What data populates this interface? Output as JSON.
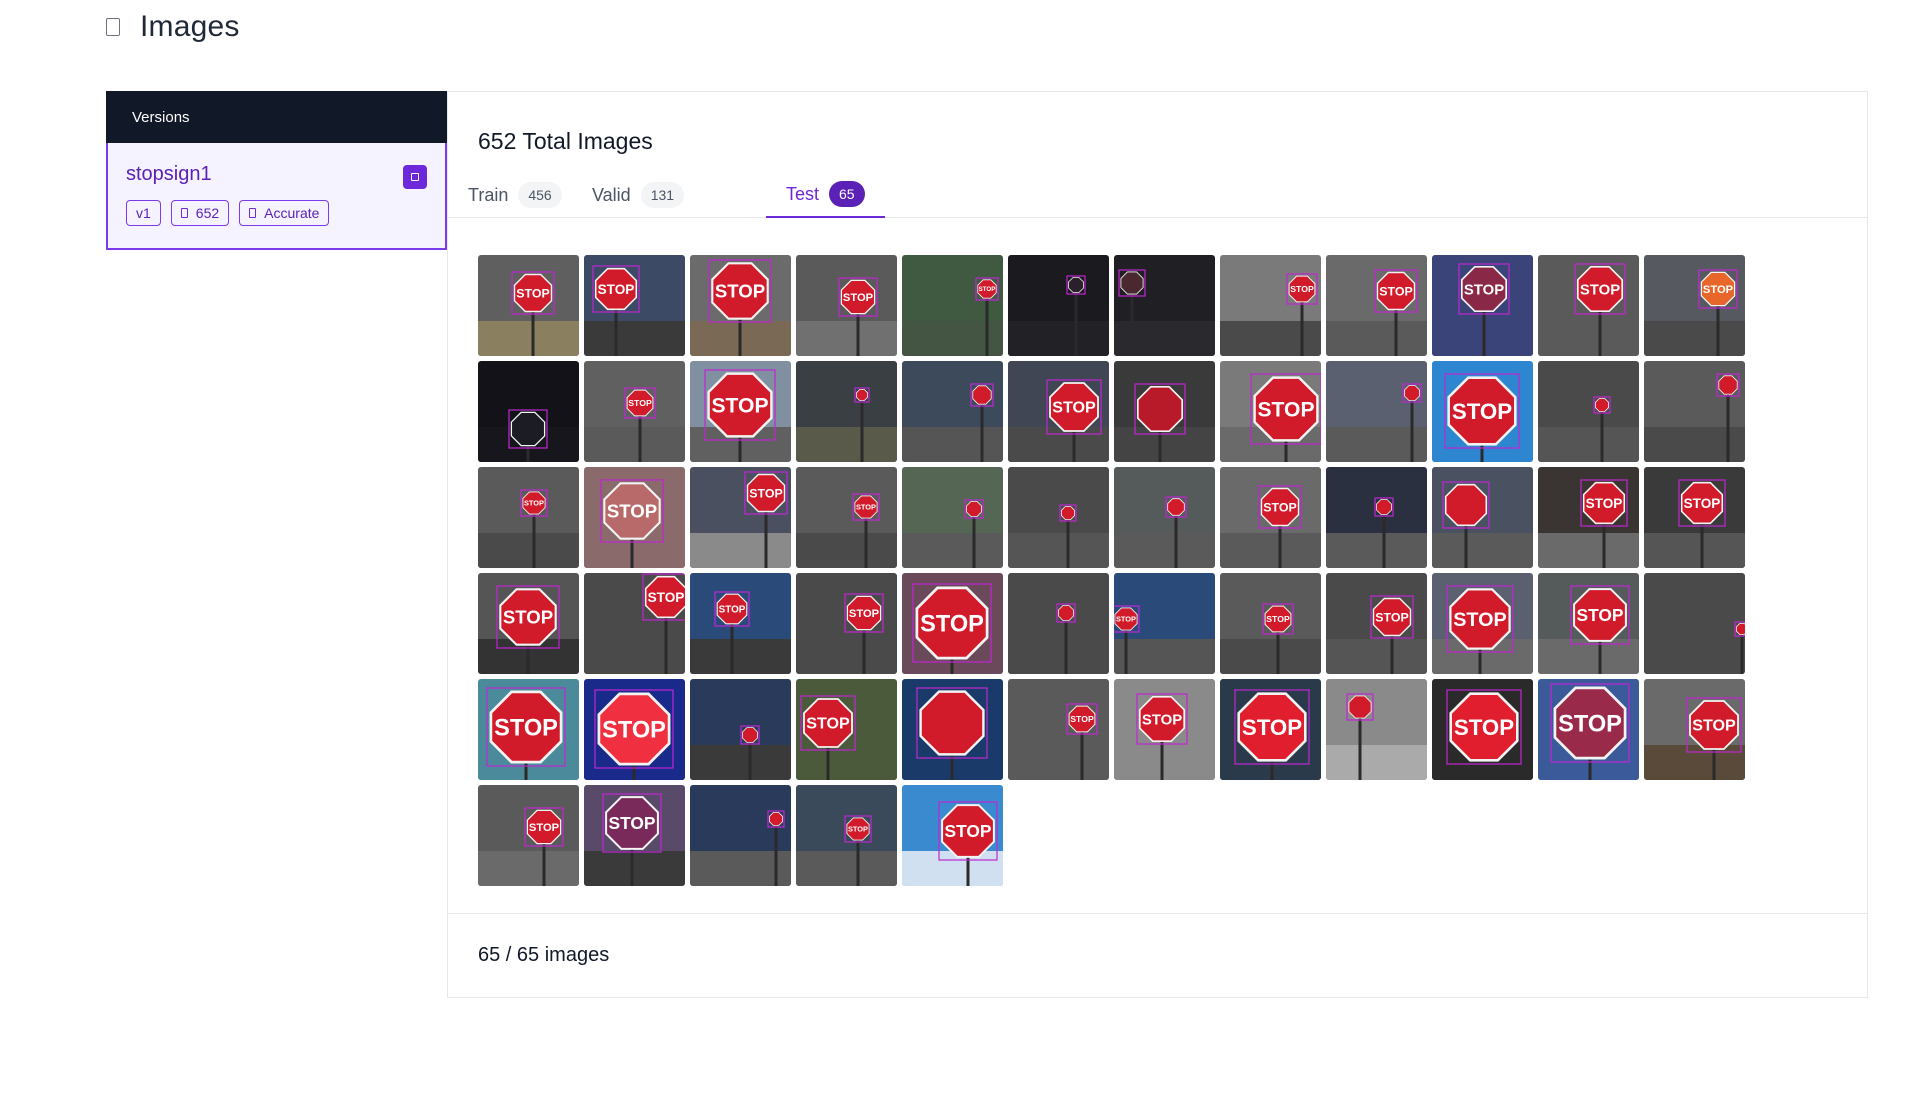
{
  "header": {
    "title": "Images",
    "icon": "image-icon"
  },
  "sidebar": {
    "title": "Versions",
    "version": {
      "name": "stopsign1",
      "chips": [
        {
          "label": "v1",
          "icon": ""
        },
        {
          "label": "652",
          "icon": "image-icon"
        },
        {
          "label": "Accurate",
          "icon": "doc-icon"
        }
      ]
    }
  },
  "main": {
    "total": "652 Total Images",
    "tabs": [
      {
        "label": "Train",
        "count": "456",
        "active": false
      },
      {
        "label": "Valid",
        "count": "131",
        "active": false
      },
      {
        "label": "Test",
        "count": "65",
        "active": true
      }
    ],
    "footer": "65 / 65 images"
  },
  "colors": {
    "accent": "#6d28d9",
    "sidebar_header": "#111827",
    "stop_red": "#d11a2a",
    "bbox": "#c026d3"
  },
  "thumbnails": [
    {
      "bg": "#5f5f5f",
      "ground": "#8a8060",
      "sign": "#d11a2a",
      "text": "STOP"
    },
    {
      "bg": "#3c4a66",
      "ground": "#3a3a3a",
      "sign": "#d11a2a",
      "text": "STOP"
    },
    {
      "bg": "#6b6b6b",
      "ground": "#7a6a55",
      "sign": "#d11a2a",
      "text": "STOP"
    },
    {
      "bg": "#5a5a5a",
      "ground": "#707070",
      "sign": "#d11a2a",
      "text": "STOP"
    },
    {
      "bg": "#3f5a40",
      "ground": "#445544",
      "sign": "#d11a2a",
      "text": "STOP"
    },
    {
      "bg": "#1a1a1f",
      "ground": "#222226",
      "sign": "#2a1f2a",
      "text": ""
    },
    {
      "bg": "#202024",
      "ground": "#2a2a2e",
      "sign": "#4a2830",
      "text": ""
    },
    {
      "bg": "#7a7a7a",
      "ground": "#4a4a4a",
      "sign": "#d11a2a",
      "text": "STOP"
    },
    {
      "bg": "#6a6a6a",
      "ground": "#5a5a5a",
      "sign": "#d11a2a",
      "text": "STOP"
    },
    {
      "bg": "#3a4478",
      "ground": "#3a4478",
      "sign": "#8a2848",
      "text": "STOP"
    },
    {
      "bg": "#5a5a5a",
      "ground": "#5a5a5a",
      "sign": "#d11a2a",
      "text": "STOP"
    },
    {
      "bg": "#565a60",
      "ground": "#4a4a4a",
      "sign": "#e8662a",
      "text": "STOP"
    },
    {
      "bg": "#121218",
      "ground": "#16161c",
      "sign": "#1c1c24",
      "text": ""
    },
    {
      "bg": "#606060",
      "ground": "#5a5a5a",
      "sign": "#d11a2a",
      "text": "STOP"
    },
    {
      "bg": "#8090a0",
      "ground": "#606060",
      "sign": "#d11a2a",
      "text": "STOP"
    },
    {
      "bg": "#3a3f44",
      "ground": "#5a5a4a",
      "sign": "#d11a2a",
      "text": ""
    },
    {
      "bg": "#3c4a5c",
      "ground": "#555555",
      "sign": "#d11a2a",
      "text": ""
    },
    {
      "bg": "#404654",
      "ground": "#4a4a4a",
      "sign": "#d11a2a",
      "text": "STOP"
    },
    {
      "bg": "#3a3a3a",
      "ground": "#444444",
      "sign": "#b81a2a",
      "text": ""
    },
    {
      "bg": "#7a7a7a",
      "ground": "#6a6a6a",
      "sign": "#d11a2a",
      "text": "STOP"
    },
    {
      "bg": "#5a6070",
      "ground": "#5a5a5a",
      "sign": "#d11a2a",
      "text": ""
    },
    {
      "bg": "#2e86d0",
      "ground": "#2e86d0",
      "sign": "#d11a2a",
      "text": "STOP"
    },
    {
      "bg": "#4a4a4a",
      "ground": "#555555",
      "sign": "#d11a2a",
      "text": ""
    },
    {
      "bg": "#5a5a5a",
      "ground": "#4a4a4a",
      "sign": "#d11a2a",
      "text": ""
    },
    {
      "bg": "#5a5a5a",
      "ground": "#4a4a4a",
      "sign": "#d11a2a",
      "text": "STOP"
    },
    {
      "bg": "#8a6a6a",
      "ground": "#8a6a6a",
      "sign": "#b86a6a",
      "text": "STOP"
    },
    {
      "bg": "#4a5060",
      "ground": "#8a8a8a",
      "sign": "#d11a2a",
      "text": "STOP"
    },
    {
      "bg": "#5a5a5a",
      "ground": "#4a4a4a",
      "sign": "#d11a2a",
      "text": "STOP"
    },
    {
      "bg": "#556655",
      "ground": "#5a5a5a",
      "sign": "#d11a2a",
      "text": ""
    },
    {
      "bg": "#4a4a4a",
      "ground": "#555555",
      "sign": "#d11a2a",
      "text": ""
    },
    {
      "bg": "#555a5a",
      "ground": "#5a5a5a",
      "sign": "#d11a2a",
      "text": ""
    },
    {
      "bg": "#6a6a6a",
      "ground": "#5a5a5a",
      "sign": "#d11a2a",
      "text": "STOP"
    },
    {
      "bg": "#2a3040",
      "ground": "#5a5a5a",
      "sign": "#d11a2a",
      "text": ""
    },
    {
      "bg": "#4a5262",
      "ground": "#5a5a5a",
      "sign": "#d11a2a",
      "text": ""
    },
    {
      "bg": "#3a3532",
      "ground": "#6a6a6a",
      "sign": "#d11a2a",
      "text": "STOP"
    },
    {
      "bg": "#3a3a3a",
      "ground": "#555555",
      "sign": "#d11a2a",
      "text": "STOP"
    },
    {
      "bg": "#555555",
      "ground": "#333333",
      "sign": "#d11a2a",
      "text": "STOP"
    },
    {
      "bg": "#4a4a4a",
      "ground": "#4a4a4a",
      "sign": "#d11a2a",
      "text": "STOP"
    },
    {
      "bg": "#2a4a7a",
      "ground": "#3a3a3a",
      "sign": "#d11a2a",
      "text": "STOP"
    },
    {
      "bg": "#4a4a4a",
      "ground": "#4a4a4a",
      "sign": "#d11a2a",
      "text": "STOP"
    },
    {
      "bg": "#6a4a5a",
      "ground": "#6a4a5a",
      "sign": "#d11a2a",
      "text": "STOP"
    },
    {
      "bg": "#4a4a4a",
      "ground": "#4a4a4a",
      "sign": "#d11a2a",
      "text": ""
    },
    {
      "bg": "#2a4a7a",
      "ground": "#555555",
      "sign": "#d11a2a",
      "text": "STOP"
    },
    {
      "bg": "#5a5a5a",
      "ground": "#4a4a4a",
      "sign": "#d11a2a",
      "text": "STOP"
    },
    {
      "bg": "#4a4a4a",
      "ground": "#555555",
      "sign": "#d11a2a",
      "text": "STOP"
    },
    {
      "bg": "#5a6070",
      "ground": "#6a6a6a",
      "sign": "#d11a2a",
      "text": "STOP"
    },
    {
      "bg": "#555a5a",
      "ground": "#6a6a6a",
      "sign": "#d11a2a",
      "text": "STOP"
    },
    {
      "bg": "#4a4a4a",
      "ground": "#4a4a4a",
      "sign": "#d11a2a",
      "text": ""
    },
    {
      "bg": "#4a8a9a",
      "ground": "#4a8a9a",
      "sign": "#d11a2a",
      "text": "STOP"
    },
    {
      "bg": "#1a2a8a",
      "ground": "#1a2a8a",
      "sign": "#f03040",
      "text": "STOP"
    },
    {
      "bg": "#2a3a5a",
      "ground": "#3a3a3a",
      "sign": "#d11a2a",
      "text": ""
    },
    {
      "bg": "#4a5a3a",
      "ground": "#4a5a3a",
      "sign": "#d11a2a",
      "text": "STOP"
    },
    {
      "bg": "#1a3a6a",
      "ground": "#1a3a6a",
      "sign": "#d11a2a",
      "text": ""
    },
    {
      "bg": "#5a5a5a",
      "ground": "#5a5a5a",
      "sign": "#d11a2a",
      "text": "STOP"
    },
    {
      "bg": "#8a8a8a",
      "ground": "#8a8a8a",
      "sign": "#d11a2a",
      "text": "STOP"
    },
    {
      "bg": "#2a3a4a",
      "ground": "#2a3a4a",
      "sign": "#e01e2e",
      "text": "STOP"
    },
    {
      "bg": "#8a8a8a",
      "ground": "#aaaaaa",
      "sign": "#d11a2a",
      "text": ""
    },
    {
      "bg": "#2a2a2a",
      "ground": "#2a2a2a",
      "sign": "#e01e2e",
      "text": "STOP"
    },
    {
      "bg": "#3a5a9a",
      "ground": "#3a5a9a",
      "sign": "#9a2a4a",
      "text": "STOP"
    },
    {
      "bg": "#6a6a6a",
      "ground": "#5a4a3a",
      "sign": "#d11a2a",
      "text": "STOP"
    },
    {
      "bg": "#5a5a5a",
      "ground": "#6a6a6a",
      "sign": "#d11a2a",
      "text": "STOP"
    },
    {
      "bg": "#5a4a6a",
      "ground": "#3a3a3a",
      "sign": "#7a2a5a",
      "text": "STOP"
    },
    {
      "bg": "#2a3a5a",
      "ground": "#5a5a5a",
      "sign": "#d11a2a",
      "text": ""
    },
    {
      "bg": "#3a4a5a",
      "ground": "#5a5a5a",
      "sign": "#d11a2a",
      "text": "STOP"
    },
    {
      "bg": "#3a8ad0",
      "ground": "#d0e0f0",
      "sign": "#d11a2a",
      "text": "STOP"
    }
  ]
}
